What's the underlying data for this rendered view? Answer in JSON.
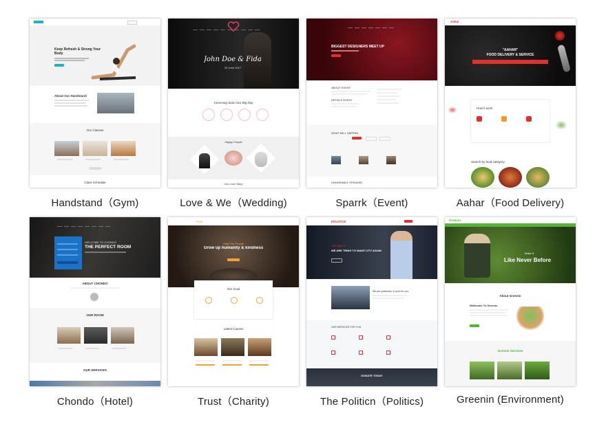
{
  "templates": [
    {
      "caption": "Handstand（Gym)",
      "texts": {
        "hero_title": "Keep Refresh & Strong Your Body",
        "about": "About Our Handstand",
        "classes": "Our Classes",
        "schedule": "Class Schedule"
      },
      "colors": {
        "accent": "#1bb4c6",
        "bg": "#f2f2f2"
      }
    },
    {
      "caption": "Love & We（Wedding)",
      "texts": {
        "names": "John Doe & Fida",
        "date": "25 June 2017",
        "coming": "Comming Soon Our Big Day",
        "couple": "Happy Couple",
        "story": "Our Love Story"
      },
      "colors": {
        "accent": "#e83e6b",
        "bg": "#111111"
      }
    },
    {
      "caption": "Sparrk（Event)",
      "texts": {
        "hero_title": "BIGGEST DESIGNERS MEET UP",
        "about": "ABOUT EVENT",
        "details": "DETAILS EVENT",
        "happen": "WHAT WILL HAPPEN",
        "speakers": "HONORABLE SPEAKER"
      },
      "colors": {
        "accent": "#e4302b",
        "bg": "#5a0b10"
      }
    },
    {
      "caption": "Aahar（Food Delivery)",
      "texts": {
        "brand": "Aahar",
        "hero_title": "\"AAHAR\"",
        "hero_sub": "FOOD DELIVERY & SERVICE",
        "how": "How it work",
        "search": "Search by food category"
      },
      "colors": {
        "accent": "#e4302b",
        "bg": "#151515"
      }
    },
    {
      "caption": "Chondo（Hotel)",
      "texts": {
        "hero_sub": "WELCOME TO CHONDO",
        "hero_title": "THE PERFECT ROOM",
        "about": "ABOUT CHONDO",
        "rooms": "OUR ROOM",
        "services": "OUR SERVICES"
      },
      "colors": {
        "accent": "#1a73c9",
        "bg": "#1a1a1a"
      }
    },
    {
      "caption": "Trust（Charity)",
      "texts": {
        "brand": "Trust",
        "hero_sub": "Help The People",
        "hero_title": "Grow up humanity & kindness",
        "goal": "Our Goal",
        "causes": "Latest Causes"
      },
      "colors": {
        "accent": "#f2a23a",
        "bg": "#3a2c22"
      }
    },
    {
      "caption": "The Politicn（Politics)",
      "texts": {
        "brand": "POLITICN",
        "hero_sub": "OUR ABILITY",
        "hero_title": "WE ARE TRING TO MAKE CITY AGAIN",
        "about": "We are politicians, & work for you.",
        "services": "OUR SERVICES FOR YOU",
        "donate": "DONATE TODAY"
      },
      "colors": {
        "accent": "#e4302b",
        "bg": "#1f2530"
      }
    },
    {
      "caption": "Greenin (Environment)",
      "texts": {
        "brand": "Greenin",
        "hero_sub": "Make It",
        "hero_title": "Like Never Before",
        "about": "About Greenin",
        "welcome": "Wellcome To Greenin",
        "services": "Greenin Services"
      },
      "colors": {
        "accent": "#56b23b",
        "bg": "#2f4a1c"
      }
    }
  ]
}
